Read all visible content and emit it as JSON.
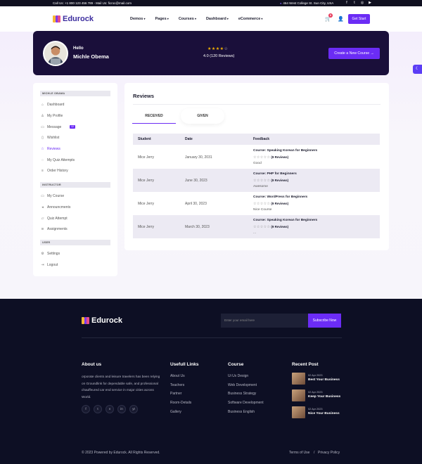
{
  "topbar": {
    "contact": "Call Us: +1 800 123 456 789 - Mail Us: ficroc@mail.com",
    "address": "464 West College St. Sun City, USA",
    "social": [
      "facebook-icon",
      "twitter-icon",
      "instagram-icon",
      "youtube-icon"
    ]
  },
  "nav": {
    "logo": "Edurock",
    "menu": [
      "Demos",
      "Pages",
      "Courses",
      "Dashboard",
      "eCommerce"
    ],
    "cart_count": "0",
    "cta": "Get Start"
  },
  "profile": {
    "greeting": "Hello",
    "name": "Michle Obema",
    "stars": "★★★★",
    "stars_empty": "☆",
    "rating": 4.0,
    "rating_text": "4.0 (120 Reviews)",
    "create_label": "Create a New Course →"
  },
  "sidebar": {
    "sections": [
      {
        "heading": "MICHLE OBAMA",
        "items": [
          {
            "label": "Dashboard",
            "icon": "home-icon"
          },
          {
            "label": "My Profile",
            "icon": "user-icon"
          },
          {
            "label": "Message",
            "icon": "book-icon",
            "badge": "12"
          },
          {
            "label": "Wishlist",
            "icon": "bookmark-icon"
          },
          {
            "label": "Reviews",
            "icon": "star-icon",
            "active": true
          },
          {
            "label": "My Quiz Attempts",
            "icon": "help-circle-icon"
          },
          {
            "label": "Order History",
            "icon": "shopping-bag-icon"
          }
        ]
      },
      {
        "heading": "INSTRUCTOR",
        "items": [
          {
            "label": "My Course",
            "icon": "monitor-icon"
          },
          {
            "label": "Announcments",
            "icon": "volume-icon"
          },
          {
            "label": "Quiz Attempt",
            "icon": "message-square-icon"
          },
          {
            "label": "Assignments",
            "icon": "layers-icon"
          }
        ]
      },
      {
        "heading": "USER",
        "items": [
          {
            "label": "Settings",
            "icon": "settings-icon"
          },
          {
            "label": "Logout",
            "icon": "logout-icon"
          }
        ]
      }
    ]
  },
  "reviews": {
    "title": "Reviews",
    "tabs": [
      "RECEIVED",
      "GIVEN"
    ],
    "columns": [
      "Student",
      "Date",
      "Feedback"
    ],
    "rows": [
      {
        "student": "Mice Jerry",
        "date": "January 30, 2031",
        "course": "Course: Speaking Korean for Beginners",
        "stars": "☆☆☆☆☆",
        "count": "(9 Reviews)",
        "text": "Good"
      },
      {
        "student": "Mice Jerry",
        "date": "June 30, 2023",
        "course": "Course: PHP for Beginners",
        "stars": "☆☆☆☆☆",
        "count": "(9 Reviews)",
        "text": "Awesome"
      },
      {
        "student": "Mice Jerry",
        "date": "April 30, 2023",
        "course": "Course: WordPress for Beginners",
        "stars": "☆☆☆☆☆",
        "count": "(9 Reviews)",
        "text": "Nice Course"
      },
      {
        "student": "Mice Jerry",
        "date": "March 30, 2023",
        "course": "Course: Speaking Korean for Beginners",
        "stars": "☆☆☆☆☆",
        "count": "(9 Reviews)",
        "text": "..."
      }
    ]
  },
  "footer": {
    "logo": "Edurock",
    "email_placeholder": "Enter your email here",
    "subscribe": "Subscribe Now",
    "about_title": "About us",
    "about_text": "orporate clients and leisure travelers has been relying on Groundlink for dependable safe, and professional chauffeured car end service in major cities across World.",
    "social": [
      "f",
      "t",
      "v",
      "in",
      "yt"
    ],
    "links_title": "Usefull Links",
    "links": [
      "About Us",
      "Teachers",
      "Partner",
      "Room-Details",
      "Gallery"
    ],
    "course_title": "Course",
    "courses": [
      "Ui Ux Design",
      "Web Development",
      "Business Strategy",
      "Software Development",
      "Business English"
    ],
    "recent_title": "Recent Post",
    "posts": [
      {
        "date": "02 Apr 2023",
        "title": "Best Your Business"
      },
      {
        "date": "02 Apr 2023",
        "title": "Keep Your Business"
      },
      {
        "date": "02 Apr 2023",
        "title": "Nice Your Business"
      }
    ],
    "copyright": "© 2023 Powered by Edurock. All Rights Reserved.",
    "terms": "Terms of Use",
    "separator": "/",
    "privacy": "Privacy Policy"
  },
  "colors": {
    "accent": "#6b2cf5",
    "banner": "#1a0f3a",
    "footer": "#0d0f24"
  }
}
